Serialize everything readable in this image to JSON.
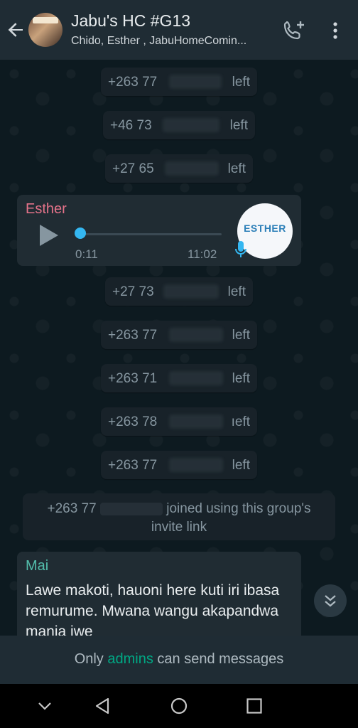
{
  "header": {
    "title": "Jabu's HC #G13",
    "subtitle": "Chido, Esther , JabuHomeComin..."
  },
  "system_messages": [
    {
      "number": "+263 77",
      "suffix": "left"
    },
    {
      "number": "+46 73",
      "suffix": "left"
    },
    {
      "number": "+27 65",
      "suffix": "left"
    },
    {
      "number": "+27 73",
      "suffix": "left"
    },
    {
      "number": "+263 77",
      "suffix": "left"
    },
    {
      "number": "+263 71",
      "suffix": "left"
    },
    {
      "number": "+263 78",
      "suffix": "ıeft"
    },
    {
      "number": "+263 77",
      "suffix": "left"
    }
  ],
  "voice_message": {
    "sender": "Esther",
    "duration": "0:11",
    "time": "11:02",
    "avatar_text": "ESTHER",
    "progress": 0
  },
  "joined_message": {
    "number": "+263 77",
    "text_1": "joined using this group's",
    "text_2": "invite link"
  },
  "text_message": {
    "sender": "Mai",
    "body": "Lawe makoti, hauoni here kuti iri ibasa remurume. Mwana wangu akapandwa manja iwe"
  },
  "footer": {
    "prefix": "Only",
    "link": "admins",
    "suffix": "can send messages"
  },
  "colors": {
    "sender_esther": "#e5738a",
    "sender_mai": "#53bdab",
    "accent": "#00a884",
    "voice_dot": "#34b7f1"
  },
  "icons": [
    "back-arrow-icon",
    "add-call-icon",
    "more-vert-icon",
    "play-icon",
    "mic-icon",
    "chevron-down-double-icon",
    "nav-back-icon",
    "nav-home-icon",
    "nav-recents-icon"
  ]
}
